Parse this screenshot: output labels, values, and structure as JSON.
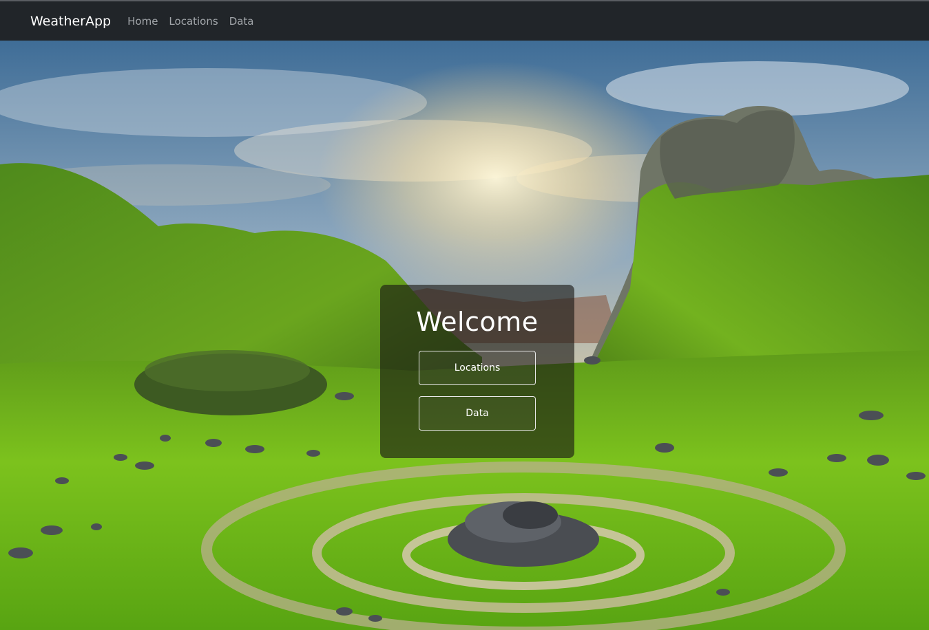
{
  "navbar": {
    "brand": "WeatherApp",
    "links": [
      "Home",
      "Locations",
      "Data"
    ]
  },
  "hero": {
    "background_description_icon": "landscape-photo",
    "title": "Welcome",
    "buttons": [
      "Locations",
      "Data"
    ]
  },
  "colors": {
    "navbar_bg": "#212529",
    "brand_text": "#ffffff",
    "nav_link": "#a3a7ab",
    "card_bg": "rgba(25,22,20,0.62)",
    "button_border": "#e9e9e9"
  }
}
